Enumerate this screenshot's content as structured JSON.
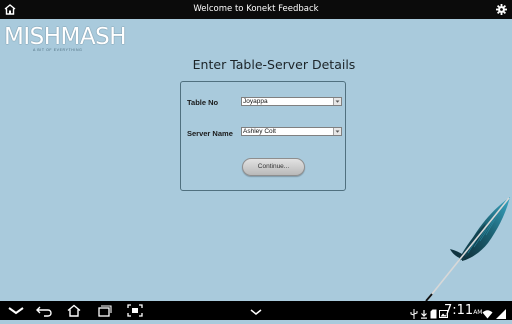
{
  "window": {
    "title": "Welcome to Konekt Feedback"
  },
  "brand": {
    "logo_text": "MISHMASH",
    "tagline": "A BIT OF EVERYTHING"
  },
  "form": {
    "heading": "Enter Table-Server Details",
    "fields": [
      {
        "label": "Table No",
        "value": "Joyappa"
      },
      {
        "label": "Server Name",
        "value": "Ashley Colt"
      }
    ],
    "continue_label": "Continue..."
  },
  "status_bar": {
    "time": "7:11",
    "ampm": "AM",
    "icons": [
      "usb-icon",
      "download-icon",
      "sd-card-icon",
      "image-icon",
      "wifi-icon",
      "signal-icon"
    ]
  },
  "nav_bar": {
    "buttons": [
      "hide-keyboard-icon",
      "back-icon",
      "home-icon",
      "recent-apps-icon",
      "screenshot-icon",
      "menu-icon"
    ]
  },
  "colors": {
    "background": "#a9cadc",
    "title_bar": "#0b0b0b",
    "panel_border": "#50707f",
    "quill_feather": "#1c5f70"
  }
}
